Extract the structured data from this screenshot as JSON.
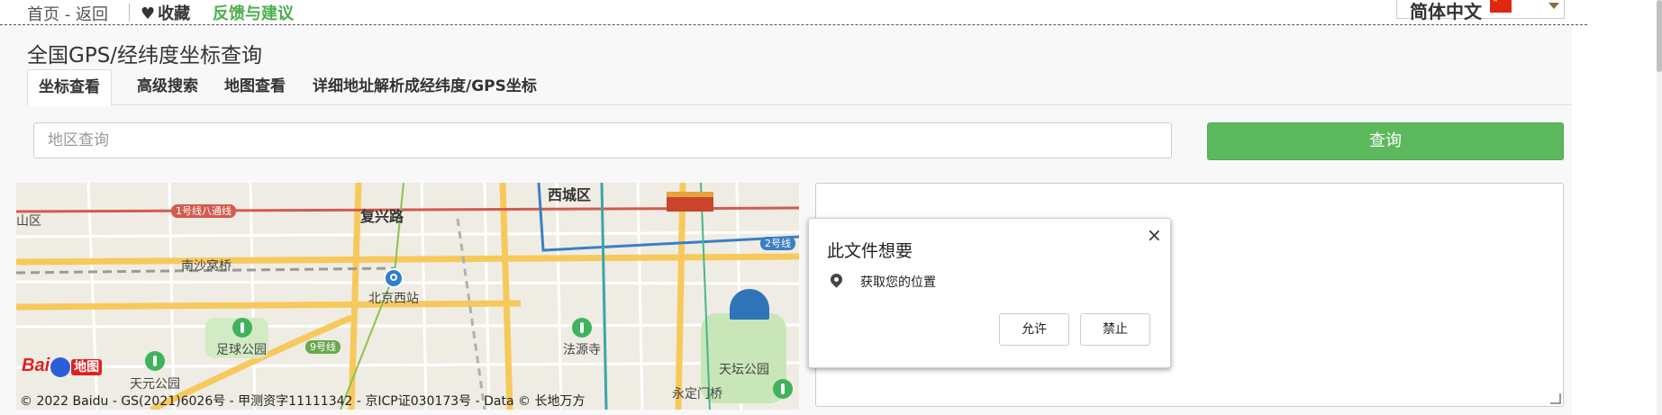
{
  "topbar": {
    "home_back": "首页 - 返回",
    "favorite": "收藏",
    "feedback": "反馈与建议",
    "language": "简体中文",
    "feedback_color": "#4cae4c"
  },
  "page_title": "全国GPS/经纬度坐标查询",
  "tabs": [
    {
      "label": "坐标查看",
      "active": true
    },
    {
      "label": "高级搜索",
      "active": false
    },
    {
      "label": "地图查看",
      "active": false
    },
    {
      "label": "详细地址解析成经纬度/GPS坐标",
      "active": false
    }
  ],
  "search": {
    "placeholder": "地区查询",
    "button_label": "查询",
    "button_color": "#5cb85c"
  },
  "map": {
    "labels": {
      "xicheng": "西城区",
      "fuxinglu": "复兴路",
      "nanshawo": "南沙窝桥",
      "beijingxi": "北京西站",
      "zuqiu": "足球公园",
      "fayuan": "法源寺",
      "tiantan": "天坛公园",
      "tianyuan": "天元公园",
      "yongding": "永定门桥",
      "edge_left": "山区"
    },
    "lines": {
      "line1": "1号线八通线",
      "line2": "2号线",
      "line9": "9号线"
    },
    "logo_text": "Bai",
    "logo_map": "地图",
    "copyright": "© 2022 Baidu - GS(2021)6026号 - 甲测资字11111342 - 京ICP证030173号 - Data © 长地万方"
  },
  "permission": {
    "title": "此文件想要",
    "request": "获取您的位置",
    "allow": "允许",
    "deny": "禁止",
    "close": "×"
  },
  "icons": [
    "heart-icon",
    "china-flag-icon",
    "dropdown-caret-icon",
    "location-pin-icon",
    "close-icon",
    "subway-station-icon",
    "park-icon"
  ]
}
